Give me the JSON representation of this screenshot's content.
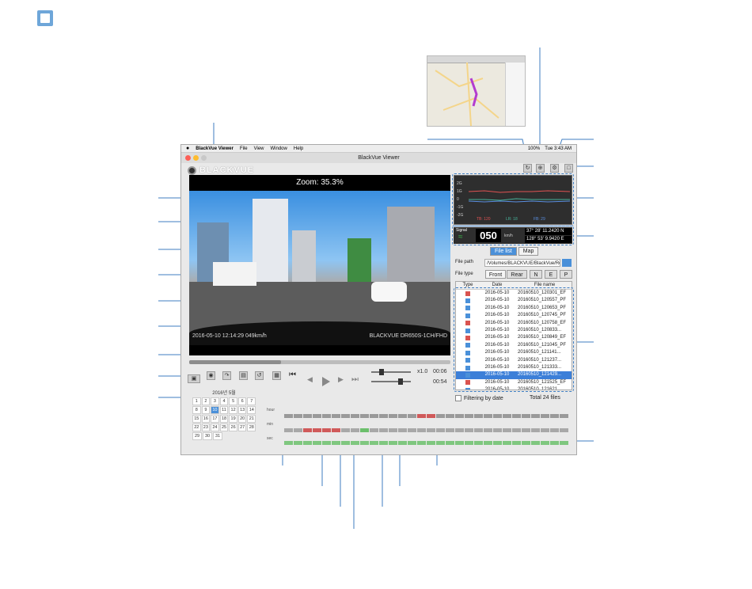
{
  "colors": {
    "accent": "#4a90d9",
    "callout": "#3f7ec2",
    "callout_dot": "#3f7ec2"
  },
  "menubar": {
    "app_name": "BlackVue Viewer",
    "items": [
      "File",
      "View",
      "Window",
      "Help"
    ],
    "clock": "Tue 3:43 AM",
    "battery": "100%"
  },
  "window": {
    "title": "BlackVue Viewer"
  },
  "brand": {
    "name": "BLACKVUE"
  },
  "video": {
    "zoom_text": "Zoom: 35.3%",
    "timestamp_left": "2016-05-10 12:14:29 049km/h",
    "timestamp_right": "BLACKVUE DR650S-1CH/FHD"
  },
  "player": {
    "speed": "x1.0",
    "elapsed": "00:06",
    "remaining": "00:54",
    "progress": 0.35
  },
  "calendar": {
    "title": "2016년 5월",
    "rows": [
      [
        "1",
        "2",
        "3",
        "4",
        "5",
        "6",
        "7"
      ],
      [
        "8",
        "9",
        "10",
        "11",
        "12",
        "13",
        "14"
      ],
      [
        "15",
        "16",
        "17",
        "18",
        "19",
        "20",
        "21"
      ],
      [
        "22",
        "23",
        "24",
        "25",
        "26",
        "27",
        "28"
      ],
      [
        "29",
        "30",
        "31"
      ]
    ],
    "selected": "10"
  },
  "timeline": {
    "labels": [
      "hour",
      "min",
      "sec"
    ]
  },
  "gsensor": {
    "labels": [
      "2G",
      "1G",
      "0",
      "-1G",
      "-2G"
    ],
    "legend": [
      "TB: 120",
      "LR: 18",
      "FB: 29"
    ]
  },
  "gps": {
    "signal_label": "Signal",
    "speed": "050",
    "unit": "km/h",
    "lat": "37° 28' 11.2420 N",
    "lon": "128° 53' 9.9420 E"
  },
  "tabs": [
    "File list",
    "Map"
  ],
  "filepath": {
    "label": "File path",
    "value": "/Volumes/BLACKVUE/BlackVue/Re"
  },
  "filetype": {
    "label": "File type",
    "buttons": [
      "Front",
      "Rear",
      "N",
      "E",
      "P"
    ]
  },
  "filelist": {
    "headers": [
      "Type",
      "Date",
      "File name"
    ],
    "rows": [
      {
        "type": "event",
        "date": "2016-05-10",
        "name": "20160510_120301_EF"
      },
      {
        "type": "normal",
        "date": "2016-05-10",
        "name": "20160510_120557_PF"
      },
      {
        "type": "normal",
        "date": "2016-05-10",
        "name": "20160510_120653_PF"
      },
      {
        "type": "normal",
        "date": "2016-05-10",
        "name": "20160510_120745_PF"
      },
      {
        "type": "event",
        "date": "2016-05-10",
        "name": "20160510_120758_EF"
      },
      {
        "type": "normal",
        "date": "2016-05-10",
        "name": "20160510_120833..."
      },
      {
        "type": "event",
        "date": "2016-05-10",
        "name": "20160510_120849_EF"
      },
      {
        "type": "normal",
        "date": "2016-05-10",
        "name": "20160510_121045_PF"
      },
      {
        "type": "normal",
        "date": "2016-05-10",
        "name": "20160510_121141..."
      },
      {
        "type": "normal",
        "date": "2016-05-10",
        "name": "20160510_121237..."
      },
      {
        "type": "normal",
        "date": "2016-05-10",
        "name": "20160510_121333..."
      },
      {
        "type": "normal",
        "date": "2016-05-10",
        "name": "20160510_121429...",
        "selected": true
      },
      {
        "type": "event",
        "date": "2016-05-10",
        "name": "20160510_121525_EF"
      },
      {
        "type": "normal",
        "date": "2016-05-10",
        "name": "20160510_121621..."
      }
    ]
  },
  "filter": {
    "label": "Filtering by date",
    "total": "Total 24 files"
  }
}
